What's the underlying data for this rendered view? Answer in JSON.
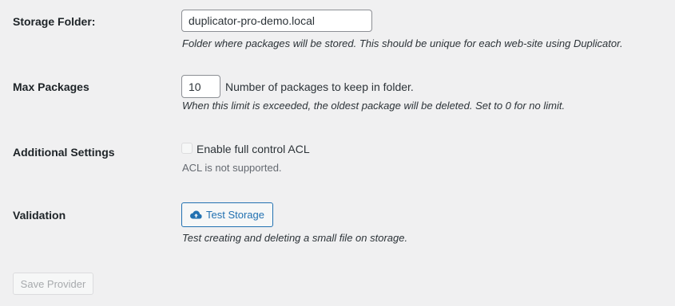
{
  "storage_folder": {
    "label": "Storage Folder:",
    "value": "duplicator-pro-demo.local",
    "description": "Folder where packages will be stored. This should be unique for each web-site using Duplicator."
  },
  "max_packages": {
    "label": "Max Packages",
    "value": "10",
    "inline_text": "Number of packages to keep in folder.",
    "description": "When this limit is exceeded, the oldest package will be deleted. Set to 0 for no limit."
  },
  "additional_settings": {
    "label": "Additional Settings",
    "checkbox_label": "Enable full control ACL",
    "checked": false,
    "note": "ACL is not supported."
  },
  "validation": {
    "label": "Validation",
    "button_label": "Test Storage",
    "button_icon": "cloud-upload-icon",
    "description": "Test creating and deleting a small file on storage."
  },
  "save_button_label": "Save Provider",
  "colors": {
    "background": "#f0f0f1",
    "accent": "#2271b1",
    "text": "#1d2327",
    "muted": "#646970",
    "disabled": "#a7aaad"
  }
}
